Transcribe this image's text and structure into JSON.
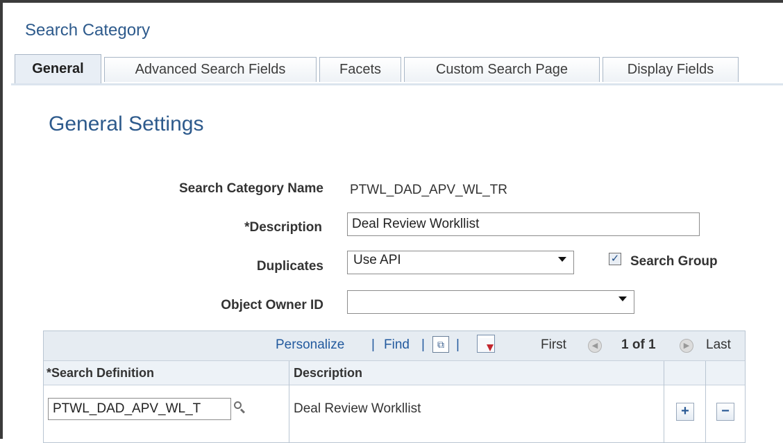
{
  "page": {
    "title": "Search Category",
    "tabs": [
      {
        "label": "General"
      },
      {
        "label": "Advanced Search Fields"
      },
      {
        "label": "Facets"
      },
      {
        "label": "Custom Search Page"
      },
      {
        "label": "Display Fields"
      }
    ],
    "section_title": "General Settings"
  },
  "form": {
    "search_category_name_label": "Search Category Name",
    "search_category_name_value": "PTWL_DAD_APV_WL_TR",
    "description_label": "*Description",
    "description_value": "Deal Review Workllist",
    "duplicates_label": "Duplicates",
    "duplicates_value": "Use API",
    "search_group_label": "Search Group",
    "search_group_checked": true,
    "object_owner_label": "Object Owner ID",
    "object_owner_value": ""
  },
  "grid": {
    "nav": {
      "personalize": "Personalize",
      "sep1": "|",
      "find": "Find",
      "sep2": "|",
      "sep3": "|",
      "first": "First",
      "position": "1 of 1",
      "last": "Last"
    },
    "columns": {
      "search_definition": "*Search Definition",
      "description": "Description"
    },
    "rows": [
      {
        "search_definition": "PTWL_DAD_APV_WL_T",
        "description": "Deal Review Workllist"
      }
    ],
    "add_symbol": "+",
    "delete_symbol": "−"
  },
  "icons": {
    "zoom": "expand-window-icon",
    "download": "download-to-excel-icon",
    "prev": "previous-arrow-icon",
    "next": "next-arrow-icon",
    "lookup": "lookup-magnifier-icon"
  },
  "colors": {
    "title_blue": "#2d5a8c",
    "link_blue": "#235a9e"
  }
}
